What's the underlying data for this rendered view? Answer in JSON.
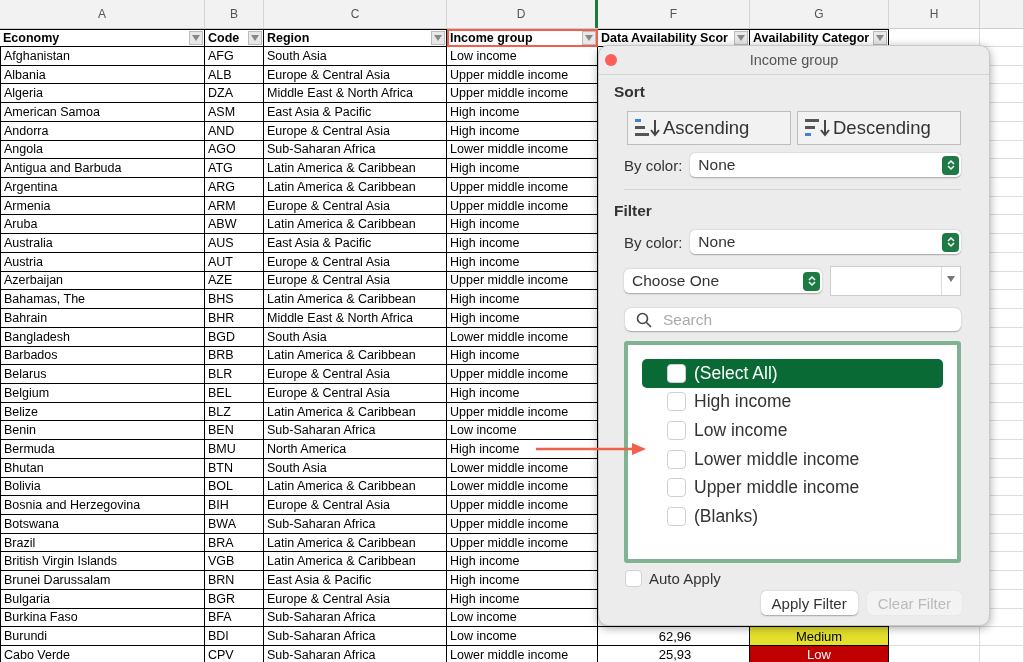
{
  "sheet": {
    "columns": [
      {
        "letter": "A",
        "header": "Economy",
        "highlighted": false,
        "filter": true
      },
      {
        "letter": "B",
        "header": "Code",
        "highlighted": false,
        "filter": true
      },
      {
        "letter": "C",
        "header": "Region",
        "highlighted": false,
        "filter": true
      },
      {
        "letter": "D",
        "header": "Income group",
        "highlighted": true,
        "filter": true
      },
      {
        "letter": "F",
        "header": "Data Availability Scor",
        "highlighted": false,
        "filter": true
      },
      {
        "letter": "G",
        "header": "Availability Categor",
        "highlighted": false,
        "filter": true
      },
      {
        "letter": "H",
        "filter": false
      }
    ],
    "rows": [
      {
        "cells": [
          "Afghanistan",
          "AFG",
          "South Asia",
          "Low income"
        ]
      },
      {
        "cells": [
          "Albania",
          "ALB",
          "Europe & Central Asia",
          "Upper middle income"
        ]
      },
      {
        "cells": [
          "Algeria",
          "DZA",
          "Middle East & North Africa",
          "Upper middle income"
        ]
      },
      {
        "cells": [
          "American Samoa",
          "ASM",
          "East Asia & Pacific",
          "High income"
        ]
      },
      {
        "cells": [
          "Andorra",
          "AND",
          "Europe & Central Asia",
          "High income"
        ]
      },
      {
        "cells": [
          "Angola",
          "AGO",
          "Sub-Saharan Africa",
          "Lower middle income"
        ]
      },
      {
        "cells": [
          "Antigua and Barbuda",
          "ATG",
          "Latin America & Caribbean",
          "High income"
        ]
      },
      {
        "cells": [
          "Argentina",
          "ARG",
          "Latin America & Caribbean",
          "Upper middle income"
        ]
      },
      {
        "cells": [
          "Armenia",
          "ARM",
          "Europe & Central Asia",
          "Upper middle income"
        ]
      },
      {
        "cells": [
          "Aruba",
          "ABW",
          "Latin America & Caribbean",
          "High income"
        ]
      },
      {
        "cells": [
          "Australia",
          "AUS",
          "East Asia & Pacific",
          "High income"
        ]
      },
      {
        "cells": [
          "Austria",
          "AUT",
          "Europe & Central Asia",
          "High income"
        ]
      },
      {
        "cells": [
          "Azerbaijan",
          "AZE",
          "Europe & Central Asia",
          "Upper middle income"
        ]
      },
      {
        "cells": [
          "Bahamas, The",
          "BHS",
          "Latin America & Caribbean",
          "High income"
        ]
      },
      {
        "cells": [
          "Bahrain",
          "BHR",
          "Middle East & North Africa",
          "High income"
        ]
      },
      {
        "cells": [
          "Bangladesh",
          "BGD",
          "South Asia",
          "Lower middle income"
        ]
      },
      {
        "cells": [
          "Barbados",
          "BRB",
          "Latin America & Caribbean",
          "High income"
        ]
      },
      {
        "cells": [
          "Belarus",
          "BLR",
          "Europe & Central Asia",
          "Upper middle income"
        ]
      },
      {
        "cells": [
          "Belgium",
          "BEL",
          "Europe & Central Asia",
          "High income"
        ]
      },
      {
        "cells": [
          "Belize",
          "BLZ",
          "Latin America & Caribbean",
          "Upper middle income"
        ]
      },
      {
        "cells": [
          "Benin",
          "BEN",
          "Sub-Saharan Africa",
          "Low income"
        ]
      },
      {
        "cells": [
          "Bermuda",
          "BMU",
          "North America",
          "High income"
        ]
      },
      {
        "cells": [
          "Bhutan",
          "BTN",
          "South Asia",
          "Lower middle income"
        ]
      },
      {
        "cells": [
          "Bolivia",
          "BOL",
          "Latin America & Caribbean",
          "Lower middle income"
        ]
      },
      {
        "cells": [
          "Bosnia and Herzegovina",
          "BIH",
          "Europe & Central Asia",
          "Upper middle income"
        ]
      },
      {
        "cells": [
          "Botswana",
          "BWA",
          "Sub-Saharan Africa",
          "Upper middle income"
        ]
      },
      {
        "cells": [
          "Brazil",
          "BRA",
          "Latin America & Caribbean",
          "Upper middle income"
        ]
      },
      {
        "cells": [
          "British Virgin Islands",
          "VGB",
          "Latin America & Caribbean",
          "High income"
        ]
      },
      {
        "cells": [
          "Brunei Darussalam",
          "BRN",
          "East Asia & Pacific",
          "High income"
        ]
      },
      {
        "cells": [
          "Bulgaria",
          "BGR",
          "Europe & Central Asia",
          "High income"
        ]
      },
      {
        "cells": [
          "Burkina Faso",
          "BFA",
          "Sub-Saharan Africa",
          "Low income"
        ]
      },
      {
        "cells": [
          "Burundi",
          "BDI",
          "Sub-Saharan Africa",
          "Low income"
        ],
        "score": "62,96",
        "category": "Medium",
        "color": "#e3df2c"
      },
      {
        "cells": [
          "Cabo Verde",
          "CPV",
          "Sub-Saharan Africa",
          "Lower middle income"
        ],
        "score": "25,93",
        "category": "Low",
        "color": "#c00000"
      }
    ]
  },
  "popup": {
    "title": "Income group",
    "sort": {
      "heading": "Sort",
      "buttons": [
        {
          "label": "Ascending",
          "kind": "ascending"
        },
        {
          "label": "Descending",
          "kind": "descending"
        }
      ],
      "color_label": "By color:",
      "color_value": "None"
    },
    "filter": {
      "heading": "Filter",
      "color_label": "By color:",
      "color_value": "None",
      "condition": "Choose One",
      "search_placeholder": "Search",
      "items": [
        {
          "label": "(Select All)",
          "checked": false,
          "selected": true
        },
        {
          "label": "High income",
          "checked": false,
          "selected": false
        },
        {
          "label": "Low income",
          "checked": false,
          "selected": false
        },
        {
          "label": "Lower middle income",
          "checked": false,
          "selected": false
        },
        {
          "label": "Upper middle income",
          "checked": false,
          "selected": false
        },
        {
          "label": "(Blanks)",
          "checked": false,
          "selected": false
        }
      ]
    },
    "auto_apply": {
      "label": "Auto Apply",
      "checked": false
    },
    "buttons": [
      {
        "label": "Apply Filter",
        "disabled": false
      },
      {
        "label": "Clear Filter",
        "disabled": true
      }
    ]
  }
}
